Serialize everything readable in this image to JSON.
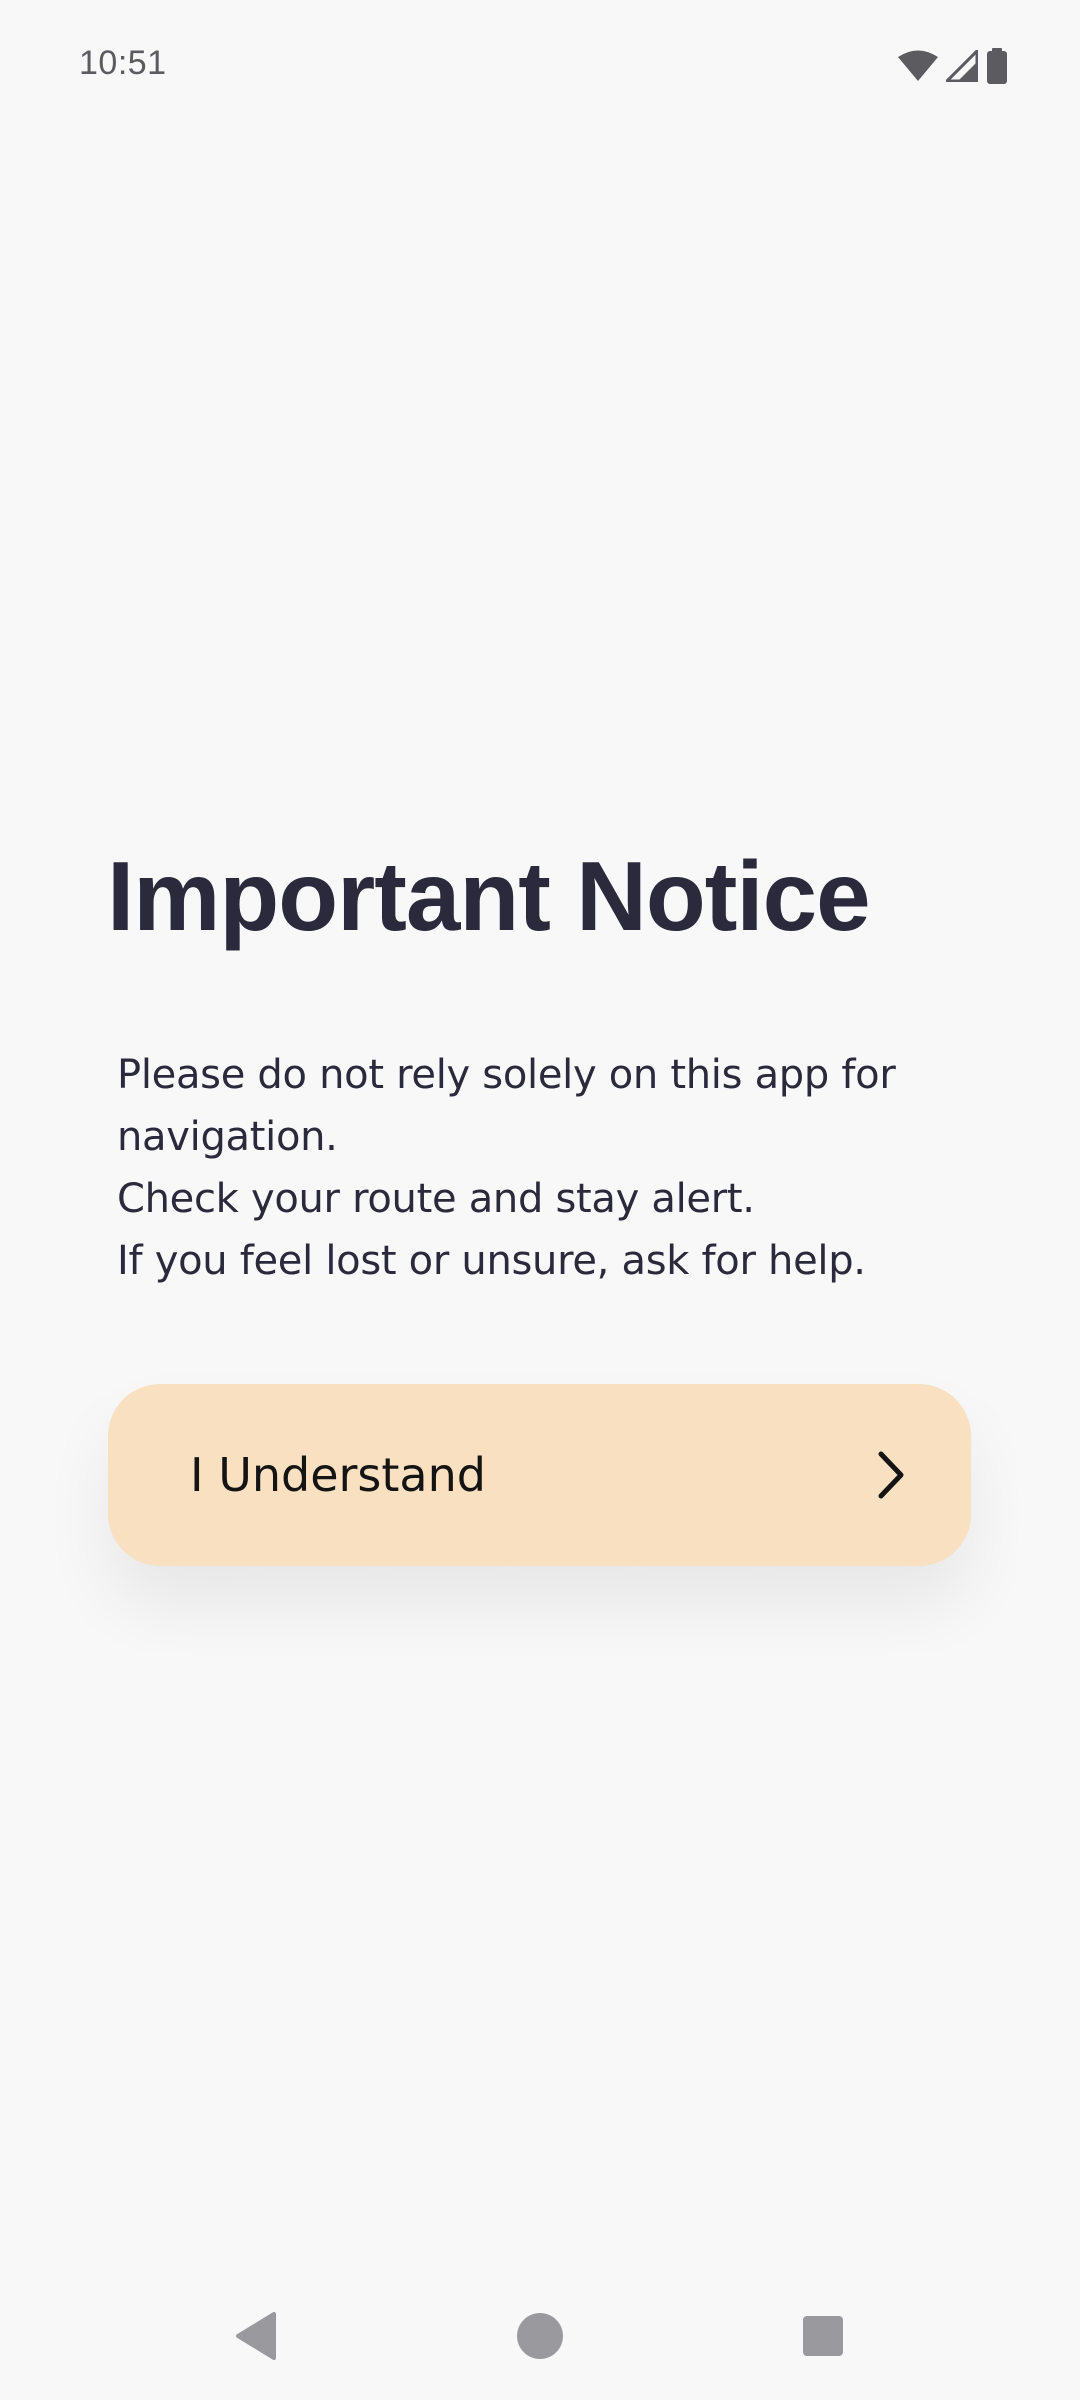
{
  "status_bar": {
    "time": "10:51",
    "icons": [
      "wifi-icon",
      "cell-signal-icon",
      "battery-icon"
    ]
  },
  "notice": {
    "title": "Important Notice",
    "lines": [
      "Please do not rely solely on this app for",
      "navigation.",
      "Check your route and stay alert.",
      "If you feel lost or unsure, ask for help."
    ]
  },
  "button": {
    "label": "I Understand",
    "icon": "chevron-right-icon",
    "background": "#f8e0c0"
  },
  "navigation_bar": {
    "buttons": [
      "back-icon",
      "home-icon",
      "recents-icon"
    ]
  },
  "colors": {
    "background": "#f8f8f9",
    "text": "#2b2a3d"
  }
}
